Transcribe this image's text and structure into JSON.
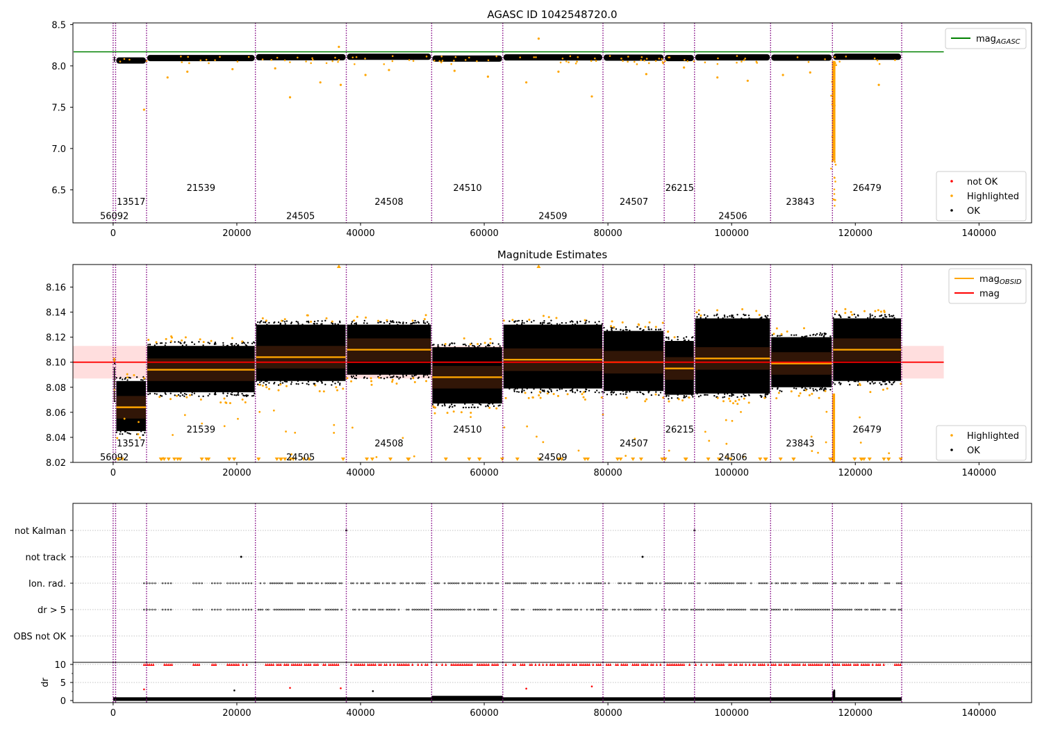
{
  "figure": {
    "panels": [
      "magnitude",
      "estimates",
      "flags"
    ]
  },
  "chart_data": [
    {
      "type": "scatter",
      "title": "AGASC ID 1042548720.0",
      "xlim": [
        -6500,
        148500
      ],
      "ylim": [
        6.1,
        8.52
      ],
      "x_ticks": [
        0,
        20000,
        40000,
        60000,
        80000,
        100000,
        120000,
        140000
      ],
      "y_ticks": [
        6.5,
        7.0,
        7.5,
        8.0,
        8.5
      ],
      "y_tick_labels": [
        "6.5",
        "7.0",
        "7.5",
        "8.0",
        "8.5"
      ],
      "legends": [
        {
          "position": "top-right",
          "entries": [
            {
              "label": "mag",
              "subscript": "AGASC",
              "marker": "line",
              "color": "#008000"
            }
          ]
        },
        {
          "position": "lower-right",
          "entries": [
            {
              "label": "not OK",
              "marker": "dot",
              "color": "#ff0000"
            },
            {
              "label": "Highlighted",
              "marker": "dot",
              "color": "#ffa500"
            },
            {
              "label": "OK",
              "marker": "dot",
              "color": "#000000"
            }
          ]
        }
      ],
      "mag_agasc": 8.17,
      "obs_boundaries": [
        0,
        400,
        5400,
        23000,
        37700,
        51500,
        63000,
        79200,
        89100,
        94000,
        106300,
        116300,
        127500
      ],
      "obs_labels": [
        {
          "text": "56092",
          "x": 200,
          "y": 6.19
        },
        {
          "text": "13517",
          "x": 2900,
          "y": 6.36
        },
        {
          "text": "21539",
          "x": 14200,
          "y": 6.53
        },
        {
          "text": "24505",
          "x": 30300,
          "y": 6.19
        },
        {
          "text": "24508",
          "x": 44600,
          "y": 6.36
        },
        {
          "text": "24510",
          "x": 57300,
          "y": 6.53
        },
        {
          "text": "24509",
          "x": 71100,
          "y": 6.19
        },
        {
          "text": "24507",
          "x": 84200,
          "y": 6.36
        },
        {
          "text": "26215",
          "x": 91600,
          "y": 6.53
        },
        {
          "text": "24506",
          "x": 100200,
          "y": 6.19
        },
        {
          "text": "23843",
          "x": 111100,
          "y": 6.36
        },
        {
          "text": "26479",
          "x": 121900,
          "y": 6.53
        }
      ],
      "series": [
        {
          "name": "OK",
          "color": "#000000",
          "segments": [
            {
              "x": [
                0,
                400
              ],
              "y": [
                8.08,
                8.08
              ]
            },
            {
              "x": [
                400,
                5400
              ],
              "y": [
                8.065,
                8.065
              ]
            },
            {
              "x": [
                5400,
                23000
              ],
              "y": [
                8.095,
                8.095
              ]
            },
            {
              "x": [
                23000,
                37700
              ],
              "y": [
                8.105,
                8.105
              ]
            },
            {
              "x": [
                37700,
                51500
              ],
              "y": [
                8.11,
                8.11
              ]
            },
            {
              "x": [
                51500,
                63000
              ],
              "y": [
                8.088,
                8.088
              ]
            },
            {
              "x": [
                63000,
                79200
              ],
              "y": [
                8.103,
                8.103
              ]
            },
            {
              "x": [
                79200,
                89100
              ],
              "y": [
                8.1,
                8.1
              ]
            },
            {
              "x": [
                89100,
                94000
              ],
              "y": [
                8.095,
                8.095
              ]
            },
            {
              "x": [
                94000,
                106300
              ],
              "y": [
                8.103,
                8.103
              ]
            },
            {
              "x": [
                106300,
                116300
              ],
              "y": [
                8.1,
                8.1
              ]
            },
            {
              "x": [
                116300,
                127500
              ],
              "y": [
                8.11,
                8.11
              ]
            }
          ]
        },
        {
          "name": "Highlighted",
          "color": "#ffa500",
          "points": [
            {
              "x": 5000,
              "y": 7.47
            },
            {
              "x": 28600,
              "y": 7.62
            },
            {
              "x": 36500,
              "y": 8.23
            },
            {
              "x": 36800,
              "y": 7.77
            },
            {
              "x": 68800,
              "y": 8.33
            },
            {
              "x": 77400,
              "y": 7.63
            },
            {
              "x": 66800,
              "y": 7.8
            },
            {
              "x": 60600,
              "y": 7.87
            },
            {
              "x": 123800,
              "y": 7.77
            },
            {
              "x": 8800,
              "y": 7.86
            },
            {
              "x": 12000,
              "y": 7.93
            },
            {
              "x": 19300,
              "y": 7.96
            },
            {
              "x": 26200,
              "y": 7.97
            },
            {
              "x": 33500,
              "y": 7.8
            },
            {
              "x": 40800,
              "y": 7.89
            },
            {
              "x": 44600,
              "y": 7.95
            },
            {
              "x": 55200,
              "y": 7.94
            },
            {
              "x": 72000,
              "y": 7.93
            },
            {
              "x": 86200,
              "y": 7.9
            },
            {
              "x": 97700,
              "y": 7.86
            },
            {
              "x": 102600,
              "y": 7.82
            },
            {
              "x": 108300,
              "y": 7.89
            },
            {
              "x": 112700,
              "y": 7.92
            },
            {
              "x": 92300,
              "y": 7.98
            }
          ]
        },
        {
          "name": "not OK",
          "color": "#ff0000",
          "points": []
        }
      ],
      "dip": {
        "x": 116500,
        "y_min": 6.3
      }
    },
    {
      "type": "scatter",
      "title": "Magnitude Estimates",
      "xlim": [
        -6500,
        148500
      ],
      "ylim": [
        8.02,
        8.178
      ],
      "x_ticks": [
        0,
        20000,
        40000,
        60000,
        80000,
        100000,
        120000,
        140000
      ],
      "y_ticks": [
        8.02,
        8.04,
        8.06,
        8.08,
        8.1,
        8.12,
        8.14,
        8.16
      ],
      "y_tick_labels": [
        "8.02",
        "8.04",
        "8.06",
        "8.08",
        "8.10",
        "8.12",
        "8.14",
        "8.16"
      ],
      "legends": [
        {
          "position": "top-right",
          "entries": [
            {
              "label": "mag",
              "subscript": "OBSID",
              "marker": "line",
              "color": "#ffa500"
            },
            {
              "label": "mag",
              "marker": "line",
              "color": "#ff0000"
            }
          ]
        },
        {
          "position": "lower-right",
          "entries": [
            {
              "label": "Highlighted",
              "marker": "dot",
              "color": "#ffa500"
            },
            {
              "label": "OK",
              "marker": "dot",
              "color": "#000000"
            }
          ]
        }
      ],
      "mag": 8.1,
      "mag_band": [
        8.087,
        8.113
      ],
      "obs_labels": [
        {
          "text": "56092",
          "x": 200,
          "y": 8.0245
        },
        {
          "text": "13517",
          "x": 2900,
          "y": 8.0355
        },
        {
          "text": "21539",
          "x": 14200,
          "y": 8.0465
        },
        {
          "text": "24505",
          "x": 30300,
          "y": 8.0245
        },
        {
          "text": "24508",
          "x": 44600,
          "y": 8.0355
        },
        {
          "text": "24510",
          "x": 57300,
          "y": 8.0465
        },
        {
          "text": "24509",
          "x": 71100,
          "y": 8.0245
        },
        {
          "text": "24507",
          "x": 84200,
          "y": 8.0355
        },
        {
          "text": "26215",
          "x": 91600,
          "y": 8.0465
        },
        {
          "text": "24506",
          "x": 100200,
          "y": 8.0245
        },
        {
          "text": "23843",
          "x": 111100,
          "y": 8.0355
        },
        {
          "text": "26479",
          "x": 121900,
          "y": 8.0465
        }
      ],
      "segments": [
        {
          "x": [
            0,
            400
          ],
          "mag_obsid": 8.078,
          "low": 8.07,
          "high": 8.096
        },
        {
          "x": [
            400,
            5400
          ],
          "mag_obsid": 8.064,
          "low": 8.045,
          "high": 8.085
        },
        {
          "x": [
            5400,
            23000
          ],
          "mag_obsid": 8.094,
          "low": 8.076,
          "high": 8.113
        },
        {
          "x": [
            23000,
            37700
          ],
          "mag_obsid": 8.104,
          "low": 8.085,
          "high": 8.13
        },
        {
          "x": [
            37700,
            51500
          ],
          "mag_obsid": 8.11,
          "low": 8.09,
          "high": 8.13
        },
        {
          "x": [
            51500,
            63000
          ],
          "mag_obsid": 8.088,
          "low": 8.067,
          "high": 8.112
        },
        {
          "x": [
            63000,
            79200
          ],
          "mag_obsid": 8.102,
          "low": 8.079,
          "high": 8.13
        },
        {
          "x": [
            79200,
            89100
          ],
          "mag_obsid": 8.1,
          "low": 8.077,
          "high": 8.125
        },
        {
          "x": [
            89100,
            94000
          ],
          "mag_obsid": 8.095,
          "low": 8.074,
          "high": 8.117
        },
        {
          "x": [
            94000,
            106300
          ],
          "mag_obsid": 8.103,
          "low": 8.075,
          "high": 8.135
        },
        {
          "x": [
            106300,
            116300
          ],
          "mag_obsid": 8.099,
          "low": 8.08,
          "high": 8.12
        },
        {
          "x": [
            116300,
            127500
          ],
          "mag_obsid": 8.11,
          "low": 8.085,
          "high": 8.135
        }
      ]
    },
    {
      "type": "scatter",
      "xlim": [
        -6500,
        148500
      ],
      "categories": [
        "not Kalman",
        "not track",
        "Ion. rad.",
        "dr > 5",
        "OBS not OK"
      ],
      "dr": {
        "ylabel": "dr",
        "ylim": [
          -0.4,
          11
        ],
        "y_ticks": [
          0,
          5,
          10
        ],
        "y_tick_labels": [
          "0",
          "5",
          "10"
        ],
        "x_ticks": [
          0,
          20000,
          40000,
          60000,
          80000,
          100000,
          120000,
          140000
        ],
        "x_tick_labels": [
          "0",
          "20000",
          "40000",
          "60000",
          "80000",
          "100000",
          "120000",
          "140000"
        ],
        "outliers": [
          {
            "x": 5000,
            "y": 3.1
          },
          {
            "x": 28600,
            "y": 3.5
          },
          {
            "x": 36800,
            "y": 3.4
          },
          {
            "x": 19600,
            "y": 2.8
          },
          {
            "x": 66800,
            "y": 3.3
          },
          {
            "x": 77400,
            "y": 3.9
          },
          {
            "x": 42000,
            "y": 2.6
          },
          {
            "x": 116600,
            "y": 2.8
          }
        ]
      },
      "flag_points": [
        {
          "category": "not track",
          "x": 20700
        },
        {
          "category": "not track",
          "x": 85600
        },
        {
          "category": "not Kalman",
          "x": 37700
        },
        {
          "category": "not Kalman",
          "x": 94000
        }
      ]
    }
  ]
}
